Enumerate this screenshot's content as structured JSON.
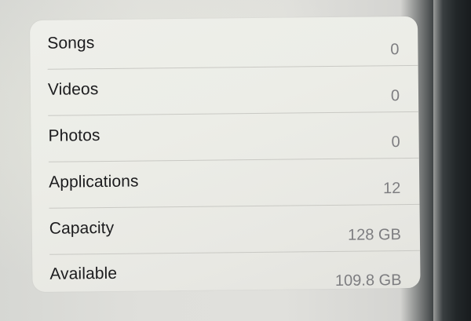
{
  "about_list": {
    "rows": [
      {
        "label": "Songs",
        "value": "0"
      },
      {
        "label": "Videos",
        "value": "0"
      },
      {
        "label": "Photos",
        "value": "0"
      },
      {
        "label": "Applications",
        "value": "12"
      },
      {
        "label": "Capacity",
        "value": "128 GB"
      },
      {
        "label": "Available",
        "value": "109.8 GB"
      }
    ]
  }
}
